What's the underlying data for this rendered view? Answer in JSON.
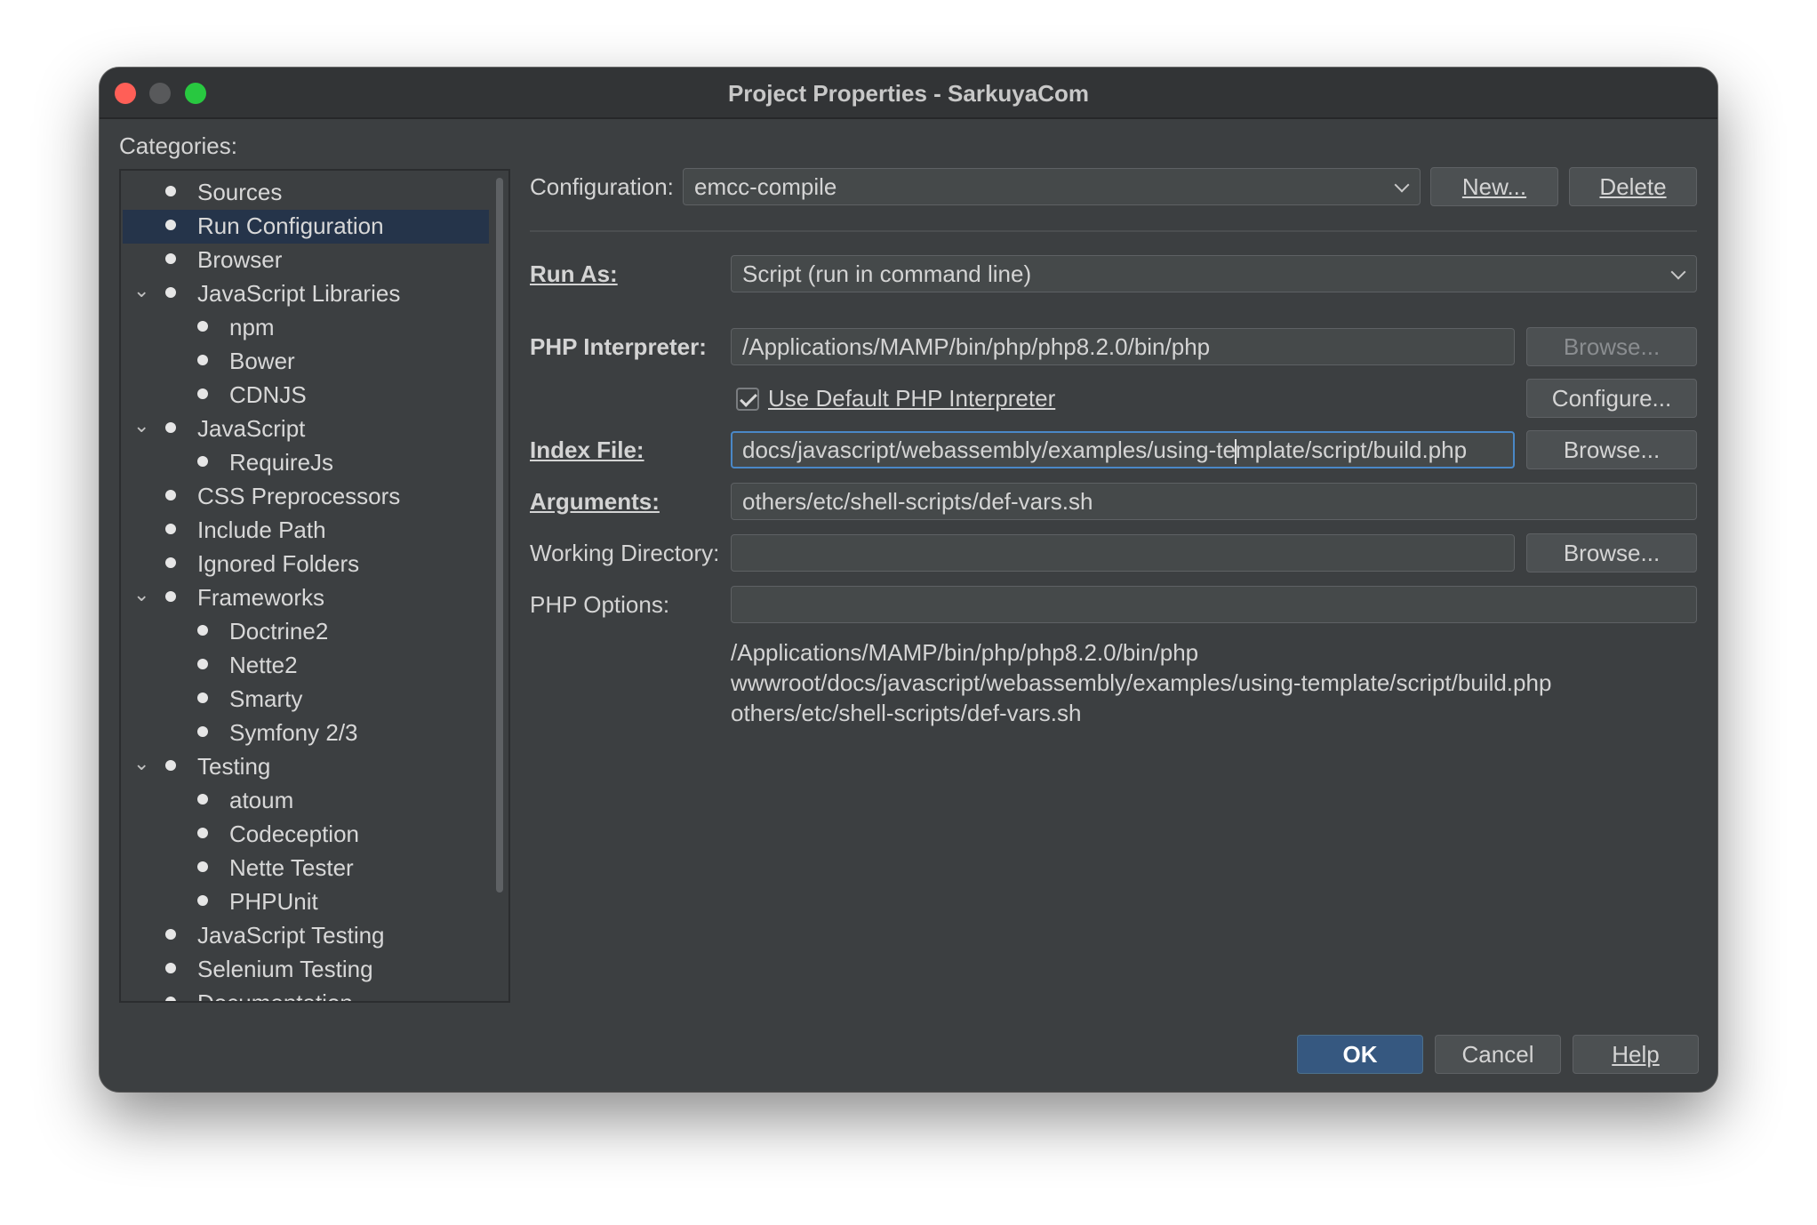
{
  "window": {
    "title": "Project Properties - SarkuyaCom",
    "controls": [
      "close",
      "minimize",
      "zoom"
    ]
  },
  "categories": {
    "label": "Categories:",
    "items": [
      {
        "label": "Sources",
        "level": 0,
        "expanded": null,
        "selected": false
      },
      {
        "label": "Run Configuration",
        "level": 0,
        "expanded": null,
        "selected": true
      },
      {
        "label": "Browser",
        "level": 0,
        "expanded": null,
        "selected": false
      },
      {
        "label": "JavaScript Libraries",
        "level": 0,
        "expanded": true,
        "selected": false
      },
      {
        "label": "npm",
        "level": 1,
        "expanded": null,
        "selected": false
      },
      {
        "label": "Bower",
        "level": 1,
        "expanded": null,
        "selected": false
      },
      {
        "label": "CDNJS",
        "level": 1,
        "expanded": null,
        "selected": false
      },
      {
        "label": "JavaScript",
        "level": 0,
        "expanded": true,
        "selected": false
      },
      {
        "label": "RequireJs",
        "level": 1,
        "expanded": null,
        "selected": false
      },
      {
        "label": "CSS Preprocessors",
        "level": 0,
        "expanded": null,
        "selected": false
      },
      {
        "label": "Include Path",
        "level": 0,
        "expanded": null,
        "selected": false
      },
      {
        "label": "Ignored Folders",
        "level": 0,
        "expanded": null,
        "selected": false
      },
      {
        "label": "Frameworks",
        "level": 0,
        "expanded": true,
        "selected": false
      },
      {
        "label": "Doctrine2",
        "level": 1,
        "expanded": null,
        "selected": false
      },
      {
        "label": "Nette2",
        "level": 1,
        "expanded": null,
        "selected": false
      },
      {
        "label": "Smarty",
        "level": 1,
        "expanded": null,
        "selected": false
      },
      {
        "label": "Symfony 2/3",
        "level": 1,
        "expanded": null,
        "selected": false
      },
      {
        "label": "Testing",
        "level": 0,
        "expanded": true,
        "selected": false
      },
      {
        "label": "atoum",
        "level": 1,
        "expanded": null,
        "selected": false
      },
      {
        "label": "Codeception",
        "level": 1,
        "expanded": null,
        "selected": false
      },
      {
        "label": "Nette Tester",
        "level": 1,
        "expanded": null,
        "selected": false
      },
      {
        "label": "PHPUnit",
        "level": 1,
        "expanded": null,
        "selected": false
      },
      {
        "label": "JavaScript Testing",
        "level": 0,
        "expanded": null,
        "selected": false
      },
      {
        "label": "Selenium Testing",
        "level": 0,
        "expanded": null,
        "selected": false
      },
      {
        "label": "Documentation",
        "level": 0,
        "expanded": null,
        "selected": false
      }
    ]
  },
  "configuration": {
    "label": "Configuration:",
    "value": "emcc-compile",
    "new_label": "New...",
    "delete_label": "Delete"
  },
  "run_as": {
    "label": "Run As:",
    "value": "Script (run in command line)"
  },
  "php_interpreter": {
    "label": "PHP Interpreter:",
    "value": "/Applications/MAMP/bin/php/php8.2.0/bin/php",
    "browse_label": "Browse...",
    "browse_enabled": false
  },
  "use_default": {
    "label": "Use Default PHP Interpreter",
    "checked": true,
    "configure_label": "Configure..."
  },
  "index_file": {
    "label": "Index File:",
    "value_before_caret": "docs/javascript/webassembly/examples/using-te",
    "value_after_caret": "mplate/script/build.php",
    "browse_label": "Browse..."
  },
  "arguments": {
    "label": "Arguments:",
    "value": "others/etc/shell-scripts/def-vars.sh"
  },
  "working_directory": {
    "label": "Working Directory:",
    "value": "",
    "browse_label": "Browse..."
  },
  "php_options": {
    "label": "PHP Options:",
    "value": ""
  },
  "command_preview": {
    "line1": "/Applications/MAMP/bin/php/php8.2.0/bin/php",
    "line2": "wwwroot/docs/javascript/webassembly/examples/using-template/script/build.php",
    "line3": "others/etc/shell-scripts/def-vars.sh"
  },
  "footer": {
    "ok_label": "OK",
    "cancel_label": "Cancel",
    "help_label": "Help"
  },
  "colors": {
    "window_bg": "#3c3f41",
    "selection": "#25344a",
    "focus_border": "#4a88c7",
    "primary_button": "#365880"
  }
}
